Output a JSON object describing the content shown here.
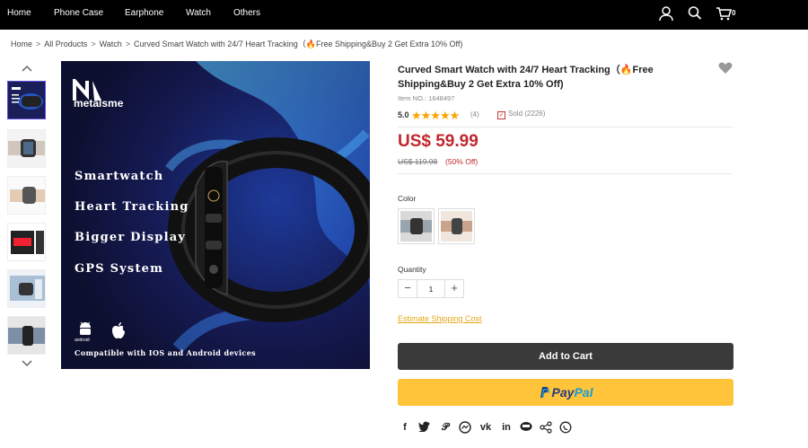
{
  "nav": {
    "items": [
      "Home",
      "Phone Case",
      "Earphone",
      "Watch",
      "Others"
    ],
    "cart_count": "0",
    "icons": [
      "user-icon",
      "search-icon",
      "cart-icon"
    ]
  },
  "breadcrumb": [
    "Home",
    "All Products",
    "Watch",
    "Curved Smart Watch with 24/7 Heart Tracking（🔥Free Shipping&Buy 2 Get Extra 10% Off)"
  ],
  "gallery": {
    "brand": "metalsme",
    "brand_logo": "N",
    "features": [
      "Smartwatch",
      "Heart Tracking",
      "Bigger Display",
      "GPS System"
    ],
    "compat": "Compatible with IOS and Android devices",
    "os_label": "android"
  },
  "product": {
    "title": "Curved Smart Watch with 24/7 Heart Tracking（🔥Free Shipping&Buy 2 Get Extra 10% Off)",
    "item_no": "Item NO.: 1648497",
    "rating": "5.0",
    "stars": "★★★★★",
    "review_count": "(4)",
    "sold": "Sold (2226)",
    "price": "US$ 59.99",
    "old_price": "US$ 119.98",
    "discount": "(50% Off)",
    "color_label": "Color",
    "quantity_label": "Quantity",
    "quantity": "1",
    "shipping_link": "Estimate Shipping Cost",
    "add_to_cart": "Add to Cart",
    "paypal": {
      "p": "P",
      "pay": "Pay",
      "pal": "Pal"
    }
  },
  "colors": {
    "price_red": "#c0272d",
    "star": "#f7a500",
    "paypal_yellow": "#ffc439",
    "link_orange": "#e6a817"
  },
  "share_icons": [
    "facebook-icon",
    "twitter-icon",
    "pinterest-icon",
    "messenger-icon",
    "vk-icon",
    "linkedin-icon",
    "line-icon",
    "share-icon",
    "whatsapp-icon"
  ]
}
